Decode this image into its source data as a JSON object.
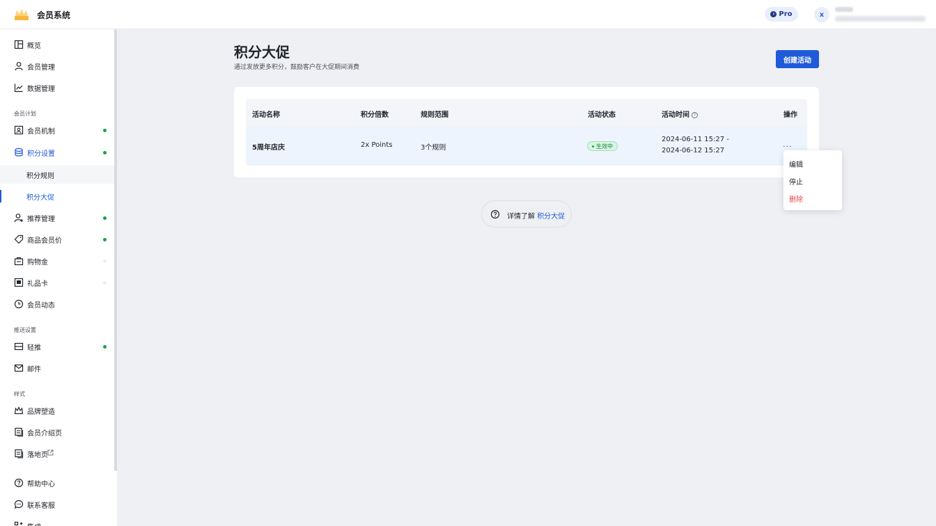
{
  "header": {
    "app_title": "会员系统",
    "pro_label": "Pro",
    "avatar_letter": "x"
  },
  "sidebar": {
    "items": [
      {
        "label": "概览"
      },
      {
        "label": "会员管理"
      },
      {
        "label": "数据管理"
      }
    ],
    "section_plan": "会员计划",
    "plan_items": [
      {
        "label": "会员机制"
      },
      {
        "label": "积分设置"
      },
      {
        "label": "积分规则"
      },
      {
        "label": "积分大促"
      },
      {
        "label": "推荐管理"
      },
      {
        "label": "商品会员价"
      },
      {
        "label": "购物金"
      },
      {
        "label": "礼品卡"
      },
      {
        "label": "会员动态"
      }
    ],
    "section_push": "推送设置",
    "push_items": [
      {
        "label": "轻推"
      },
      {
        "label": "邮件"
      }
    ],
    "section_style": "样式",
    "style_items": [
      {
        "label": "品牌塑造"
      },
      {
        "label": "会员介绍页"
      },
      {
        "label": "落地页"
      }
    ],
    "bottom_items": [
      {
        "label": "帮助中心"
      },
      {
        "label": "联系客服"
      },
      {
        "label": "集成"
      }
    ]
  },
  "main": {
    "title": "积分大促",
    "subtitle": "通过发放更多积分，鼓励客户在大促期间消费",
    "create_button": "创建活动",
    "table": {
      "columns": [
        "活动名称",
        "积分倍数",
        "规则范围",
        "活动状态",
        "活动时间",
        "操作"
      ],
      "rows": [
        {
          "name": "5周年店庆",
          "multiplier": "2x Points",
          "scope": "3个规则",
          "status": "生效中",
          "time_start": "2024-06-11 15:27 -",
          "time_end": "2024-06-12 15:27",
          "actions": "..."
        }
      ]
    },
    "row_menu": [
      "编辑",
      "停止",
      "删除"
    ],
    "learn_more": {
      "prefix": "详情了解",
      "link": "积分大促"
    }
  },
  "colors": {
    "accent": "#1f5ad8",
    "status_green": "#16a34a",
    "danger": "#e5484d"
  }
}
